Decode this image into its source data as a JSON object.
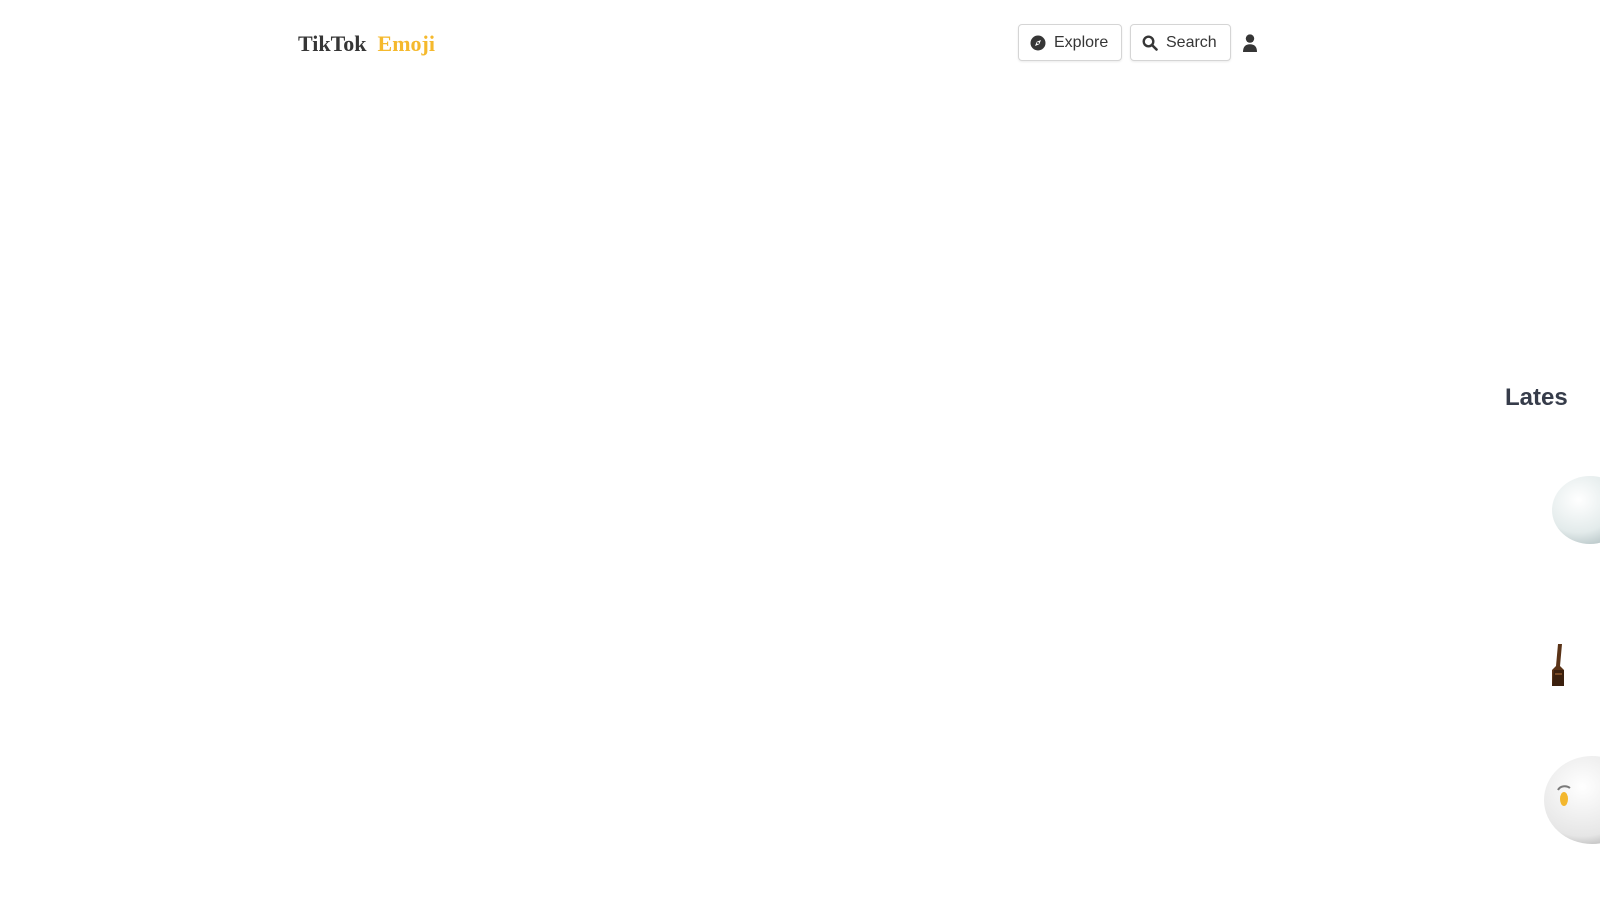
{
  "brand": {
    "part1": "TikTok",
    "part2": "Emoji",
    "accent_color": "#F5B92D",
    "text_color": "#363636"
  },
  "nav": {
    "explore": {
      "label": "Explore",
      "icon": "compass-icon"
    },
    "search": {
      "label": "Search",
      "icon": "search-icon"
    },
    "account": {
      "icon": "user-icon"
    }
  },
  "latest": {
    "heading": "Lates",
    "items": [
      {
        "icon": "emoji-thumbnail-ghost"
      },
      {
        "icon": "emoji-thumbnail-hand"
      },
      {
        "icon": "emoji-thumbnail-face"
      }
    ]
  }
}
